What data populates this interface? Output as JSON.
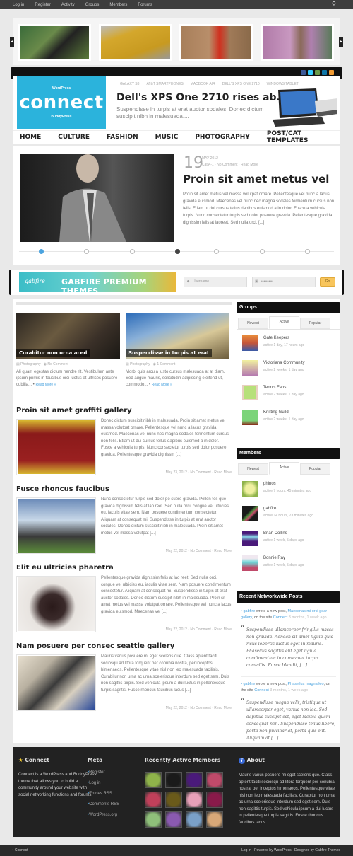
{
  "topbar": {
    "links": [
      "Log in",
      "Register",
      "Activity",
      "Groups",
      "Members",
      "Forums"
    ],
    "search_icon": "search-icon"
  },
  "carousel": {
    "items": [
      {
        "alt": "woman in black dress",
        "color": "#3a6b3a"
      },
      {
        "alt": "yellow handbag",
        "color": "#d4a72c"
      },
      {
        "alt": "woman in red dress in field",
        "color": "#a87f5a"
      },
      {
        "alt": "woman with pink blossoms",
        "color": "#b07aa8"
      }
    ],
    "prev_icon": "chevron-left-icon",
    "next_icon": "chevron-right-icon"
  },
  "masthead": {
    "social": [
      {
        "name": "facebook",
        "color": "#3b5998"
      },
      {
        "name": "twitter",
        "color": "#33ccff"
      },
      {
        "name": "google",
        "color": "#6a9a4a"
      },
      {
        "name": "linkedin",
        "color": "#0e76a8"
      },
      {
        "name": "rss",
        "color": "#f39c33"
      }
    ]
  },
  "header": {
    "logo": {
      "top": "WordPress",
      "main": "connect",
      "bottom": "BuddyPress"
    },
    "links": [
      "GALAXY S3",
      "AT&T SMARTPHONES",
      "MACBOOK AIR",
      "DELL'S XPS ONE 2710",
      "WINDOWS TABLET"
    ],
    "featured_title": "Dell's XPS One 2710 rises ab...",
    "featured_desc": "Suspendisse in turpis at erat auctor sodales. Donec dictum suscipit nibh in malesuada...."
  },
  "nav": {
    "items": [
      "HOME",
      "CULTURE",
      "FASHION",
      "MUSIC",
      "PHOTOGRAPHY",
      "POST/CAT TEMPLATES"
    ]
  },
  "slider": {
    "day": "19",
    "month": "MAY 2012",
    "meta": "Cat A-1  ·  No Comment · Read More",
    "title": "Proin sit amet metus vel",
    "text": "Proin sit amet metus vel massa volutpat ornare. Pellentesque vel nunc a lacus gravida euismod. Maecenas vel nunc nec magna sodales fermentum cursus non felis. Etiam ut dui cursus tellus dapibus euismod a in dolor. Fusce a vehicula turpis. Nunc consectetur turpis sed dolor posuere gravida. Pellentesque gravida dignissim felis at laoreet. Sed nulla orci, [...]",
    "dots": 7,
    "active_dot": 1
  },
  "login": {
    "banner_logo": "gabfire",
    "banner_text": "GABFIRE PREMIUM THEMES",
    "username_placeholder": "Username",
    "password_value": "•••••••••",
    "go_label": "Go"
  },
  "cards": [
    {
      "caption": "Curabitur non urna aced",
      "category": "Photography",
      "comments": "No Comment",
      "text": "Ali quam egestas dictum hendre rit. Vestibulum ante ipsum primis in faucibus orci luctus et ultrices posuere cubilia... • ",
      "read_more": "Read More »"
    },
    {
      "caption": "Suspendisse in turpis at erat",
      "category": "Photography",
      "comments": "1 Comment",
      "text": "Morbi quis arcu a justo cursus malesuada at at diam. Sed augue mauris, solicitudin adipiscing eleifend ut, commodo... • ",
      "read_more": "Read More »"
    }
  ],
  "posts": [
    {
      "title": "Proin sit amet graffiti gallery",
      "text": "Donec dictum suscipit nibh in malesuada. Proin sit amet metus vel massa volutpat ornare. Pellentesque vel nunc a lacus gravida euismod. Maecenas vel nunc nec magna sodales fermentum cursus non felis. Etiam ut dui cursus tellus dapibus euismod a in dolor. Fusce a vehicula turpis. Nunc consectetur turpis sed dolor posuere gravida. Pellentesque gravida dignissm [...]",
      "meta": "May 23, 2012  ·  No Comment · Read More"
    },
    {
      "title": "Fusce rhoncus faucibus",
      "text": "Nunc consectetur turpis sed dolor po suere gravida. Pellen tes que gravida dignissim felis at lao reet. Sed nulla orci, congue vel ultricies eu, iaculis vitae sem. Nam posuere condimentum consectetur. Aliquam at consequat mi. Suspendisse in turpis at erat auctor sodales. Donec dictum suscipit nibh in malesuada. Proin sit amet metus vel massa volutpat [...]",
      "meta": "May 22, 2012  ·  No Comment · Read More"
    },
    {
      "title": "Elit eu ultricies pharetra",
      "text": "Pellentesque gravida dignissim felis at lao reet. Sed nulla orci, congue vel ultricies eu, iaculis vitae sem. Nam posuere condimentum consectetur. Aliquam at consequat mi. Suspendisse in turpis at erat auctor sodales. Donec dictum suscipit nibh in malesuada. Proin sit amet metus vel massa volutpat ornare. Pellentesque vel nunc a lacus gravida euismod. Maecenas vel [...]",
      "meta": "May 22, 2012  ·  No Comment · Read More"
    },
    {
      "title": "Nam posuere per consec seattle gallery",
      "text": "Mauris varius posuere mi eget sceleris que. Class aptent taciti sociosqu ad litora torquent per conubia nostra, per inceptos himenaeos. Pellentesque vitae nisl non leo malesuada facilisis. Curabitur non urna ac urna scelerisque interdum sed eget sem. Duis non sagittis turpis. Sed vehicula ipsum a dui luctus in pellentesque turpis sagittis. Fusce rhoncus faucibus lacus [...]",
      "meta": "May 22, 2012  ·  No Comment · Read More"
    }
  ],
  "sidebar": {
    "groups": {
      "title": "Groups",
      "tabs": [
        "Newest",
        "Active",
        "Popular"
      ],
      "active_tab": 1,
      "items": [
        {
          "name": "Gate Keepers",
          "active": "active 1 day, 17 hours ago",
          "color": "#c4553a"
        },
        {
          "name": "Victoriana Community",
          "active": "active 2 weeks, 1 day ago",
          "color": "#b57ab0"
        },
        {
          "name": "Tennis Fans",
          "active": "active 2 weeks, 1 day ago",
          "color": "#b7e07a"
        },
        {
          "name": "Knitting Guild",
          "active": "active 2 weeks, 1 day ago",
          "color": "#7bd47a"
        }
      ]
    },
    "members": {
      "title": "Members",
      "tabs": [
        "Newest",
        "Active",
        "Popular"
      ],
      "active_tab": 1,
      "items": [
        {
          "name": "phinos",
          "active": "active 7 hours, 45 minutes ago",
          "color": "#8fb34a"
        },
        {
          "name": "gabfire",
          "active": "active 14 hours, 23 minutes ago",
          "color": "#1a1a1a"
        },
        {
          "name": "Brian Collins",
          "active": "active 1 week, 5 days ago",
          "color": "#4a1a7a"
        },
        {
          "name": "Bonnie Ray",
          "active": "active 1 week, 5 days ago",
          "color": "#c04a6a"
        }
      ]
    },
    "networkwide": {
      "title": "Recent Networkwide Posts",
      "posts": [
        {
          "author": "gabfire",
          "wrote": " wrote a new post, ",
          "post": "Maecenas mi orci gear gallery",
          "on_site": ", on the site ",
          "site": "Connect",
          "ago": " 3 months, 1 week ago",
          "excerpt": "Suspendisse ullamcorper fringilla massa non gravida. Aenean sit amet ligula quis risus lobortis luctus eget in mauris. Phasellus sagittis elit eget ligula condimentum in consequat turpis convallis. Fusce blandit, [...]"
        },
        {
          "author": "gabfire",
          "wrote": " wrote a new post, ",
          "post": "Phasellus magna leo",
          "on_site": ", on the site ",
          "site": "Connect",
          "ago": " 3 months, 1 week ago",
          "excerpt": "Suspendisse magna velit, tristique ut ullamcorper eget, varius non leo. Sed dapibus suscipit est, eget lacinia quam consequat non. Suspendisse tellus libero, porta non pulvinar at, porta quis elit. Aliquam at [...]"
        }
      ]
    }
  },
  "footer": {
    "connect": {
      "title": "Connect",
      "text": "Connect is a WordPress and BuddyPress theme that allows you to build a community around your website with social networking functions and forums."
    },
    "meta": {
      "title": "Meta",
      "links": [
        "Register",
        "Log in",
        "Entries RSS",
        "Comments RSS",
        "WordPress.org"
      ]
    },
    "recent": {
      "title": "Recently Active Members",
      "avatars": [
        "#8fb34a",
        "#1a1a1a",
        "#4a1a7a",
        "#c04a6a",
        "#c0405a",
        "#6a5a1a",
        "#e8a0b8",
        "#8a1a4a",
        "#8fc07a",
        "#8a5ab0",
        "#7aa0c8",
        "#d8a878"
      ]
    },
    "about": {
      "title": "About",
      "text": "Mauris varius posuere mi eget sceleris que. Class aptent taciti sociosqu ad litora torquent per conubia nostra, per inceptos himenaeos. Pellentesque vitae nisl non leo malesuada facilisis. Curabitur non urna ac urna scelerisque interdum sed eget sem. Duis non sagittis turpis. Sed vehicula ipsum a dui luctus in pellentesque turpis sagittis. Fusce rhoncus faucibus lacus"
    }
  },
  "bottombar": {
    "left": "↑ Connect",
    "right": "Log in - Powered by WordPress - Designed by Gabfire Themes"
  }
}
